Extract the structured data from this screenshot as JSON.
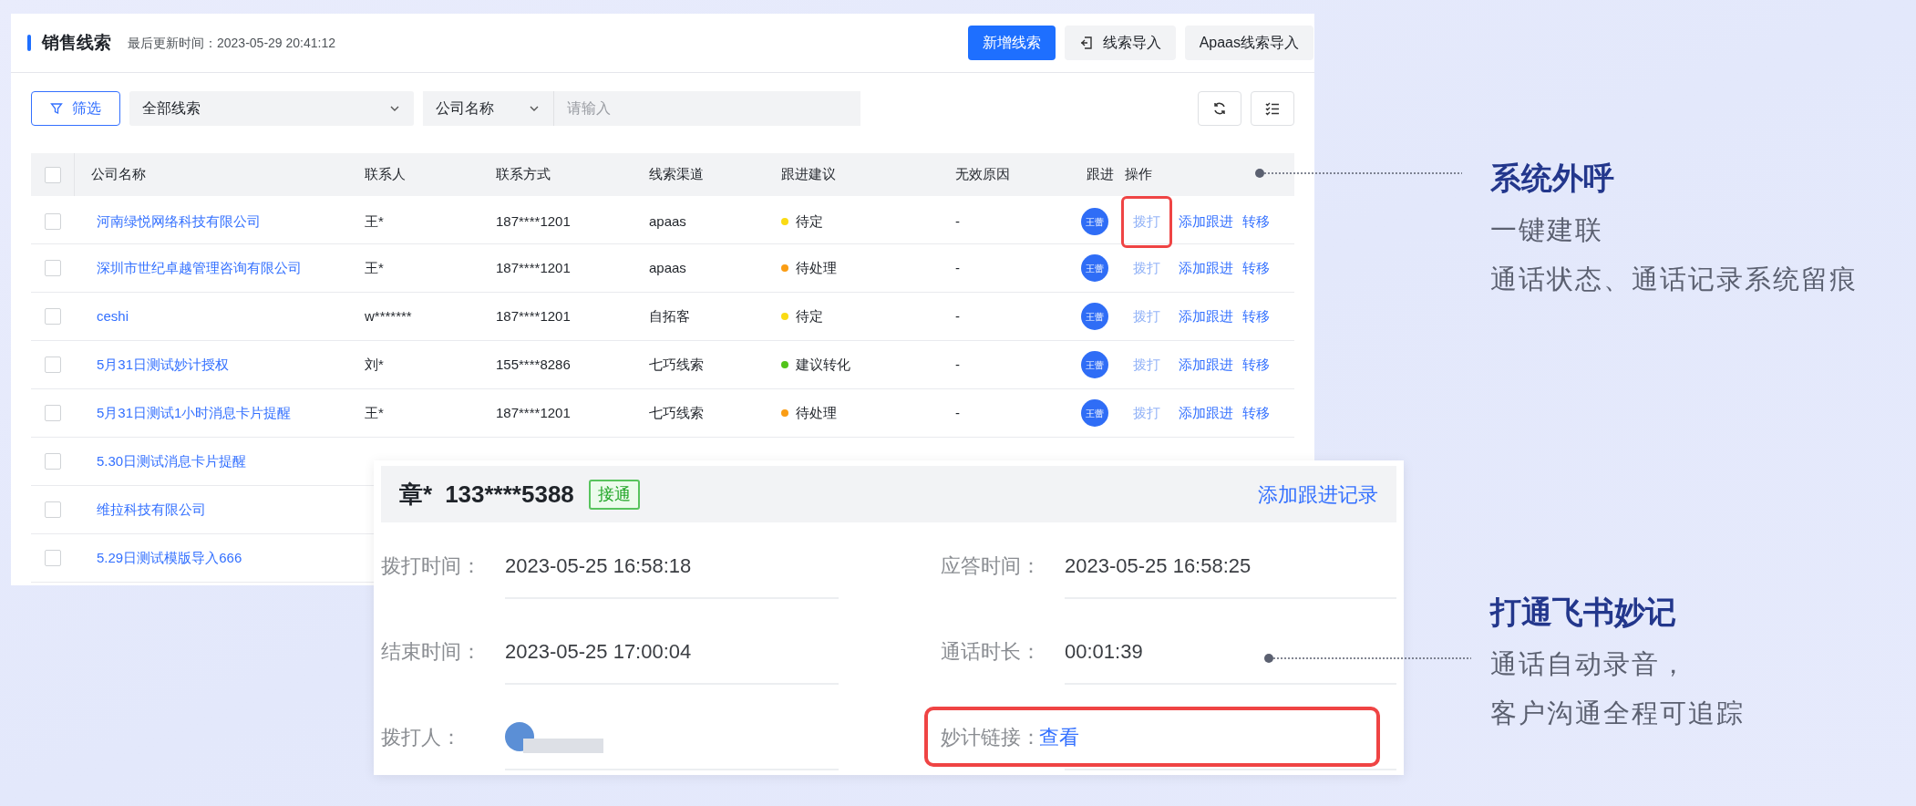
{
  "header": {
    "title": "销售线索",
    "updated": "最后更新时间：2023-05-29 20:41:12",
    "buttons": [
      {
        "label": "新增线索",
        "kind": "primary"
      },
      {
        "label": "线索导入",
        "kind": "import"
      },
      {
        "label": "Apaas线索导入",
        "kind": "plain"
      }
    ]
  },
  "filters": {
    "filter_button": "筛选",
    "scope": "全部线索",
    "field": "公司名称",
    "placeholder": "请输入"
  },
  "table": {
    "select_all": {
      "checked": false
    },
    "columns": [
      "公司名称",
      "联系人",
      "联系方式",
      "线索渠道",
      "跟进建议",
      "无效原因",
      "跟进",
      "操作"
    ],
    "rows": [
      {
        "checked": false,
        "company": "河南绿悦网络科技有限公司",
        "contact": "王*",
        "phone": "187****1201",
        "channel": "apaas",
        "advice": {
          "label": "待定",
          "color": "#fadb14"
        },
        "reason": "-",
        "owner": "王蕾",
        "actions": [
          {
            "label": "拨打",
            "kind": "dial",
            "highlighted": true
          },
          {
            "label": "添加跟进",
            "kind": "link",
            "highlighted": false
          },
          {
            "label": "转移",
            "kind": "link",
            "highlighted": false
          }
        ]
      },
      {
        "checked": false,
        "company": "深圳市世纪卓越管理咨询有限公司",
        "contact": "王*",
        "phone": "187****1201",
        "channel": "apaas",
        "advice": {
          "label": "待处理",
          "color": "#fa9d14"
        },
        "reason": "-",
        "owner": "王蕾",
        "actions": [
          {
            "label": "拨打",
            "kind": "dial",
            "highlighted": false
          },
          {
            "label": "添加跟进",
            "kind": "link",
            "highlighted": false
          },
          {
            "label": "转移",
            "kind": "link",
            "highlighted": false
          }
        ]
      },
      {
        "checked": false,
        "company": "ceshi",
        "contact": "w*******",
        "phone": "187****1201",
        "channel": "自拓客",
        "advice": {
          "label": "待定",
          "color": "#fadb14"
        },
        "reason": "-",
        "owner": "王蕾",
        "actions": [
          {
            "label": "拨打",
            "kind": "dial",
            "highlighted": false
          },
          {
            "label": "添加跟进",
            "kind": "link",
            "highlighted": false
          },
          {
            "label": "转移",
            "kind": "link",
            "highlighted": false
          }
        ]
      },
      {
        "checked": false,
        "company": "5月31日测试妙计授权",
        "contact": "刘*",
        "phone": "155****8286",
        "channel": "七巧线索",
        "advice": {
          "label": "建议转化",
          "color": "#52c41a"
        },
        "reason": "-",
        "owner": "王蕾",
        "actions": [
          {
            "label": "拨打",
            "kind": "dial",
            "highlighted": false
          },
          {
            "label": "添加跟进",
            "kind": "link",
            "highlighted": false
          },
          {
            "label": "转移",
            "kind": "link",
            "highlighted": false
          }
        ]
      },
      {
        "checked": false,
        "company": "5月31日测试1小时消息卡片提醒",
        "contact": "王*",
        "phone": "187****1201",
        "channel": "七巧线索",
        "advice": {
          "label": "待处理",
          "color": "#fa9d14"
        },
        "reason": "-",
        "owner": "王蕾",
        "actions": [
          {
            "label": "拨打",
            "kind": "dial",
            "highlighted": false
          },
          {
            "label": "添加跟进",
            "kind": "link",
            "highlighted": false
          },
          {
            "label": "转移",
            "kind": "link",
            "highlighted": false
          }
        ]
      },
      {
        "checked": false,
        "company": "5.30日测试消息卡片提醒"
      },
      {
        "checked": false,
        "company": "维拉科技有限公司"
      },
      {
        "checked": false,
        "company": "5.29日测试模版导入666"
      }
    ]
  },
  "popup": {
    "name": "章*",
    "phone": "133****5388",
    "status": "接通",
    "action": "添加跟进记录",
    "fields": [
      {
        "label": "拨打时间：",
        "value": "2023-05-25 16:58:18",
        "kind": "text",
        "highlighted": false
      },
      {
        "label": "应答时间：",
        "value": "2023-05-25 16:58:25",
        "kind": "text",
        "highlighted": false
      },
      {
        "label": "结束时间：",
        "value": "2023-05-25 17:00:04",
        "kind": "text",
        "highlighted": false
      },
      {
        "label": "通话时长：",
        "value": "00:01:39",
        "kind": "text",
        "highlighted": false
      },
      {
        "label": "拨打人：",
        "kind": "avatar",
        "highlighted": false
      },
      {
        "label": "妙计链接：",
        "value": "查看",
        "kind": "link",
        "highlighted": true
      }
    ]
  },
  "callouts": [
    {
      "title": "系统外呼",
      "lines": [
        "一键建联",
        "通话状态、通话记录系统留痕"
      ]
    },
    {
      "title": "打通飞书妙记",
      "lines": [
        "通话自动录音，",
        "客户沟通全程可追踪"
      ]
    }
  ]
}
